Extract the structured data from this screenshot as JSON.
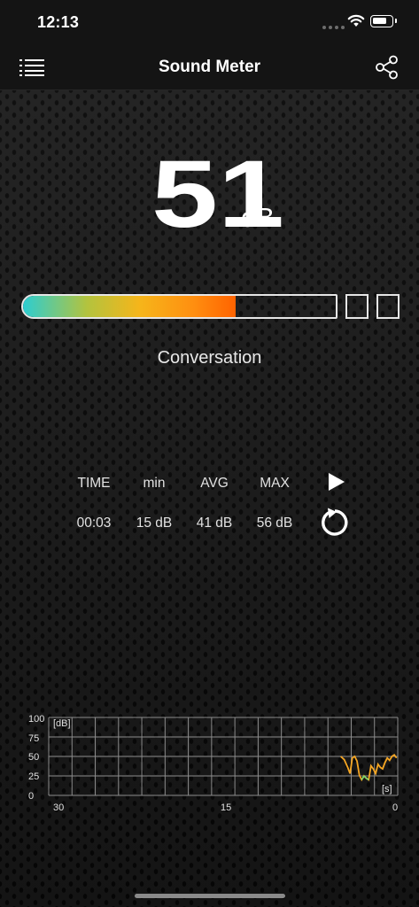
{
  "status_bar": {
    "time": "12:13"
  },
  "nav": {
    "title": "Sound Meter",
    "menu_icon": "list-menu-icon",
    "share_icon": "share-icon"
  },
  "meter": {
    "reading": "51",
    "unit": "dB",
    "level_fraction": 0.68,
    "category": "Conversation"
  },
  "stats": {
    "headers": {
      "time": "TIME",
      "min": "min",
      "avg": "AVG",
      "max": "MAX"
    },
    "values": {
      "time": "00:03",
      "min": "15 dB",
      "avg": "41 dB",
      "max": "56 dB"
    },
    "play_icon": "play-icon",
    "reset_icon": "reset-icon"
  },
  "graph": {
    "y_unit": "[dB]",
    "x_unit": "[s]",
    "y_ticks": [
      "100",
      "75",
      "50",
      "25",
      "0"
    ],
    "x_ticks": [
      "30",
      "15",
      "0"
    ],
    "colors": {
      "line": "#f5a623",
      "low": "#7ad36b",
      "grid": "#8c8c8c"
    }
  },
  "chart_data": {
    "type": "line",
    "x": [
      4.9,
      4.6,
      4.3,
      4.1,
      3.9,
      3.7,
      3.5,
      3.3,
      3.1,
      2.9,
      2.7,
      2.5,
      2.3,
      2.1,
      1.9,
      1.7,
      1.5,
      1.3,
      1.1,
      0.9,
      0.7,
      0.5,
      0.3,
      0.1
    ],
    "values": [
      50,
      46,
      36,
      28,
      48,
      50,
      44,
      26,
      20,
      25,
      22,
      20,
      38,
      34,
      28,
      40,
      36,
      34,
      42,
      48,
      45,
      50,
      52,
      48
    ],
    "xlabel": "[s]",
    "ylabel": "[dB]",
    "xlim": [
      30,
      0
    ],
    "ylim": [
      0,
      100
    ],
    "x_ticks": [
      30,
      15,
      0
    ],
    "y_ticks": [
      0,
      25,
      50,
      75,
      100
    ],
    "grid": true
  }
}
